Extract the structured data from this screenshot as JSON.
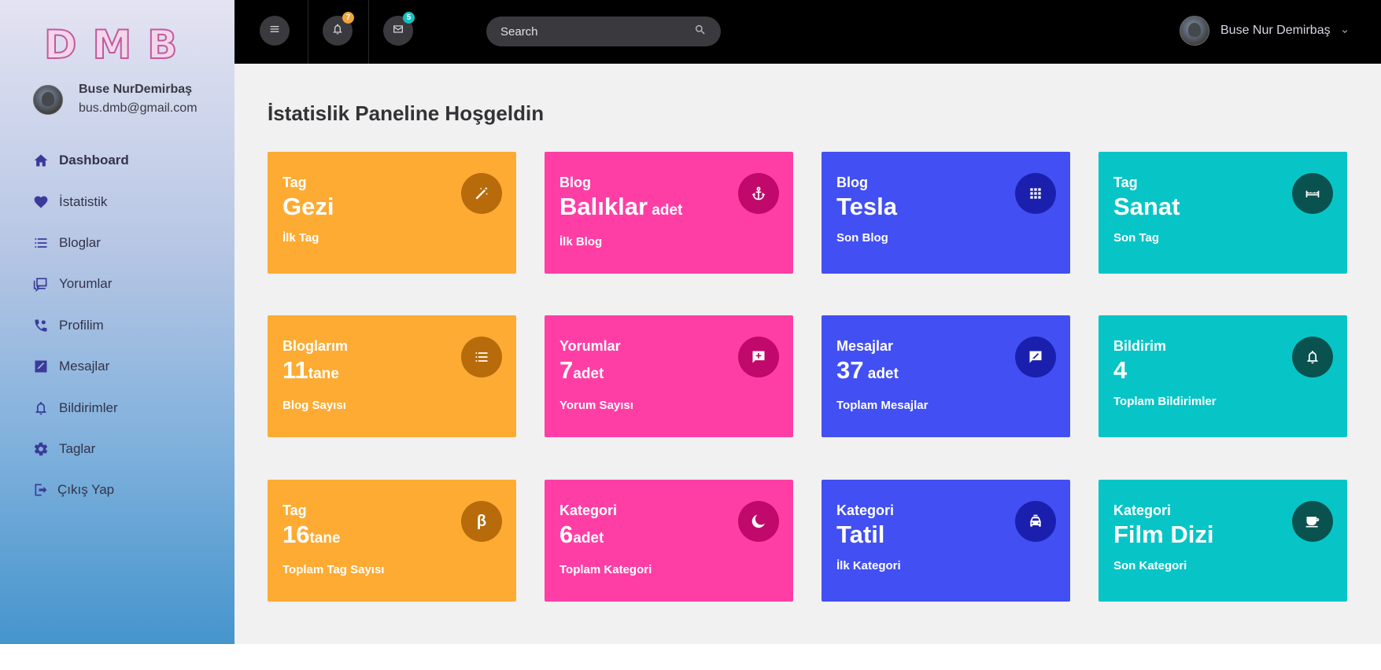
{
  "logo": {
    "letters": [
      "D",
      "M",
      "B"
    ]
  },
  "profile": {
    "name": "Buse NurDemirbaş",
    "email": "bus.dmb@gmail.com"
  },
  "sidebar": {
    "items": [
      {
        "label": "Dashboard",
        "icon": "home-icon"
      },
      {
        "label": "İstatistik",
        "icon": "heart-icon"
      },
      {
        "label": "Bloglar",
        "icon": "list-icon"
      },
      {
        "label": "Yorumlar",
        "icon": "comments-icon"
      },
      {
        "label": "Profilim",
        "icon": "phone-icon"
      },
      {
        "label": "Mesajlar",
        "icon": "message-icon"
      },
      {
        "label": "Bildirimler",
        "icon": "bell-icon"
      },
      {
        "label": "Taglar",
        "icon": "gear-icon"
      },
      {
        "label": "Çıkış Yap",
        "icon": "logout-icon"
      }
    ]
  },
  "topbar": {
    "notifications_count": "7",
    "messages_count": "5",
    "search_placeholder": "Search",
    "user_name": "Buse Nur Demirbaş"
  },
  "main": {
    "title": "İstatislik Paneline Hoşgeldin",
    "cards": [
      {
        "category": "Tag",
        "value": "Gezi",
        "unit": "",
        "subtitle": "İlk Tag",
        "color": "#fdab33",
        "icon_bg": "#b76b0a",
        "icon": "magic-wand-icon"
      },
      {
        "category": "Blog",
        "value": "Balıklar",
        "unit": " adet",
        "subtitle": "İlk Blog",
        "color": "#ff3ea5",
        "icon_bg": "#c1086b",
        "icon": "anchor-icon"
      },
      {
        "category": "Blog",
        "value": "Tesla",
        "unit": "",
        "subtitle": "Son Blog",
        "color": "#414ff3",
        "icon_bg": "#1a20ad",
        "icon": "grid-icon"
      },
      {
        "category": "Tag",
        "value": "Sanat",
        "unit": "",
        "subtitle": "Son Tag",
        "color": "#07c5c7",
        "icon_bg": "#09524f",
        "icon": "bridge-icon"
      },
      {
        "category": "Bloglarım",
        "value": "11",
        "unit": "tane",
        "subtitle": "Blog Sayısı",
        "color": "#fdab33",
        "icon_bg": "#b76b0a",
        "icon": "list-icon"
      },
      {
        "category": "Yorumlar",
        "value": "7",
        "unit": "adet",
        "subtitle": "Yorum Sayısı",
        "color": "#ff3ea5",
        "icon_bg": "#c1086b",
        "icon": "comment-add-icon"
      },
      {
        "category": "Mesajlar",
        "value": "37",
        "unit": " adet",
        "subtitle": "Toplam Mesajlar",
        "color": "#414ff3",
        "icon_bg": "#1a20ad",
        "icon": "message-icon"
      },
      {
        "category": "Bildirim",
        "value": "4",
        "unit": "",
        "subtitle": "Toplam Bildirimler",
        "color": "#07c5c7",
        "icon_bg": "#09524f",
        "icon": "bell-icon"
      },
      {
        "category": "Tag",
        "value": "16",
        "unit": "tane",
        "subtitle": "Toplam Tag Sayısı",
        "color": "#fdab33",
        "icon_bg": "#b76b0a",
        "icon": "beta-icon",
        "icon_glyph": "β"
      },
      {
        "category": "Kategori",
        "value": "6",
        "unit": "adet",
        "subtitle": "Toplam Kategori",
        "color": "#ff3ea5",
        "icon_bg": "#c1086b",
        "icon": "moon-icon"
      },
      {
        "category": "Kategori",
        "value": "Tatil",
        "unit": "",
        "subtitle": "İlk Kategori",
        "color": "#414ff3",
        "icon_bg": "#1a20ad",
        "icon": "taxi-icon"
      },
      {
        "category": "Kategori",
        "value": "Film Dizi",
        "unit": "",
        "subtitle": "Son Kategori",
        "color": "#07c5c7",
        "icon_bg": "#09524f",
        "icon": "coffee-icon"
      }
    ]
  }
}
